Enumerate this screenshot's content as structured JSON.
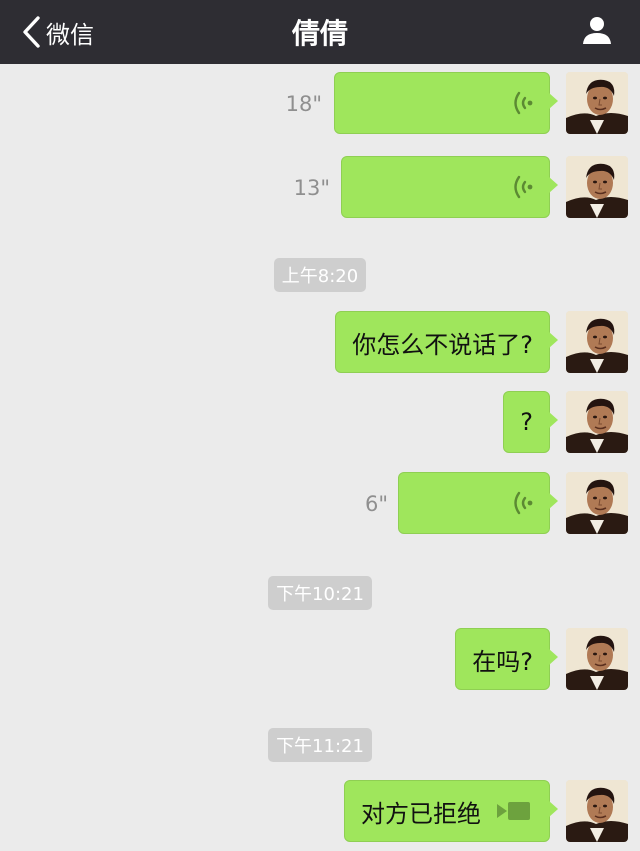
{
  "nav": {
    "back_label": "微信",
    "title": "倩倩"
  },
  "messages": {
    "voice1": {
      "duration": "18\""
    },
    "voice2": {
      "duration": "13\""
    },
    "time1": "上午8:20",
    "text1": "你怎么不说话了?",
    "text2": "?",
    "voice3": {
      "duration": "6\""
    },
    "time2": "下午10:21",
    "text3": "在吗?",
    "time3": "下午11:21",
    "call": "对方已拒绝"
  },
  "colors": {
    "nav_bg": "#2e2d33",
    "bubble": "#9fe65c",
    "chat_bg": "#ebebeb",
    "timestamp_bg": "#cecece"
  },
  "icons": [
    "chevron-left-icon",
    "user-profile-icon",
    "voice-wave-icon",
    "video-call-icon"
  ]
}
